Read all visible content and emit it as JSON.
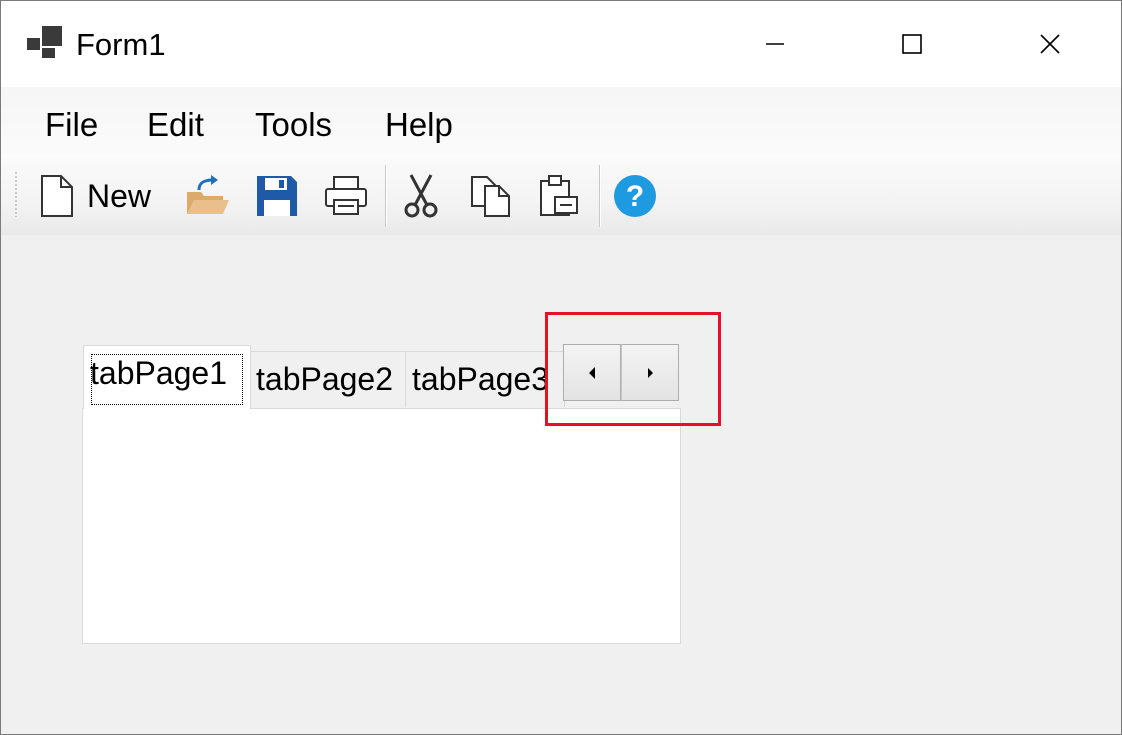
{
  "window": {
    "title": "Form1",
    "controls": {
      "minimize": "minimize",
      "maximize": "maximize",
      "close": "close"
    }
  },
  "menu": {
    "items": [
      {
        "label": "File"
      },
      {
        "label": "Edit"
      },
      {
        "label": "Tools"
      },
      {
        "label": "Help"
      }
    ]
  },
  "toolbar": {
    "new_label": "New",
    "icons": [
      "new-document-icon",
      "open-folder-icon",
      "save-icon",
      "print-icon",
      "cut-icon",
      "copy-icon",
      "paste-icon",
      "help-icon"
    ]
  },
  "tabs": {
    "items": [
      {
        "label": "tabPage1",
        "selected": true
      },
      {
        "label": "tabPage2",
        "selected": false
      },
      {
        "label": "tabPage3",
        "selected": false
      }
    ],
    "scroll_buttons": [
      "scroll-left-icon",
      "scroll-right-icon"
    ]
  },
  "colors": {
    "window_bg": "#f0f0f0",
    "highlight_box": "#e81123",
    "save_icon": "#1e5aa8",
    "open_folder": "#dcaa6a",
    "help_icon": "#1e9be0"
  }
}
